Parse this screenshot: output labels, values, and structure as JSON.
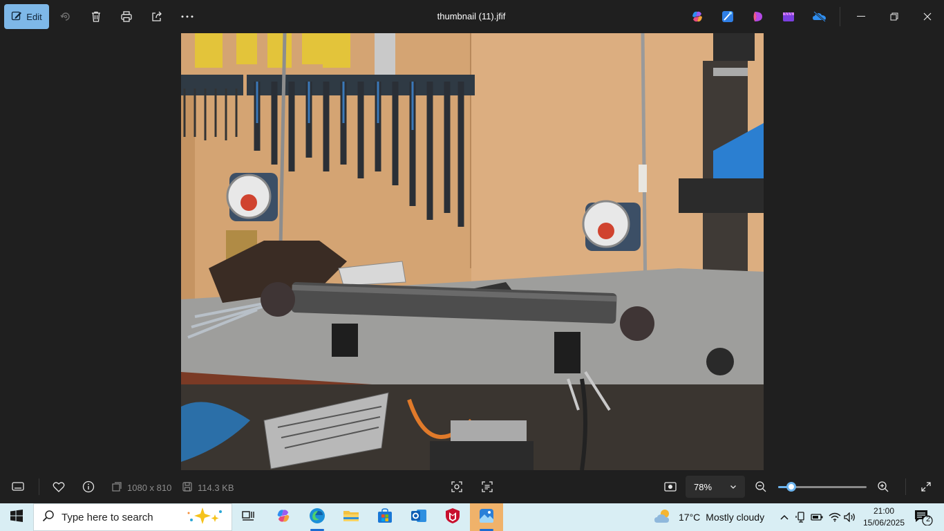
{
  "toolbar": {
    "edit_label": "Edit",
    "file_title": "thumbnail (11).jfif",
    "icons": [
      "edit-icon",
      "rotate-icon",
      "delete-icon",
      "print-icon",
      "share-icon",
      "more-icon"
    ],
    "app_icons": [
      "copilot-icon",
      "designer-icon",
      "clipchamp-icon",
      "video-editor-icon",
      "onedrive-icon"
    ]
  },
  "window_controls": [
    "minimize-icon",
    "restore-icon",
    "close-icon"
  ],
  "photo": {
    "description_icon": "photo",
    "colors": {
      "wall": "#d7a875",
      "bench": "#9a9a98",
      "tube": "#4d4d4d"
    }
  },
  "bottom": {
    "dimensions": "1080 x 810",
    "file_size": "114.3 KB",
    "zoom_value": "78%",
    "zoom_level": 0.15
  },
  "taskbar": {
    "search_placeholder": "Type here to search",
    "weather_temp": "17°C",
    "weather_text": "Mostly cloudy",
    "time": "21:00",
    "date": "15/06/2025",
    "notification_count": "2"
  },
  "colors": {
    "accent": "#7eb8e8",
    "taskbar_bg": "#d9eef4",
    "app_bg": "#1f1f1f"
  }
}
